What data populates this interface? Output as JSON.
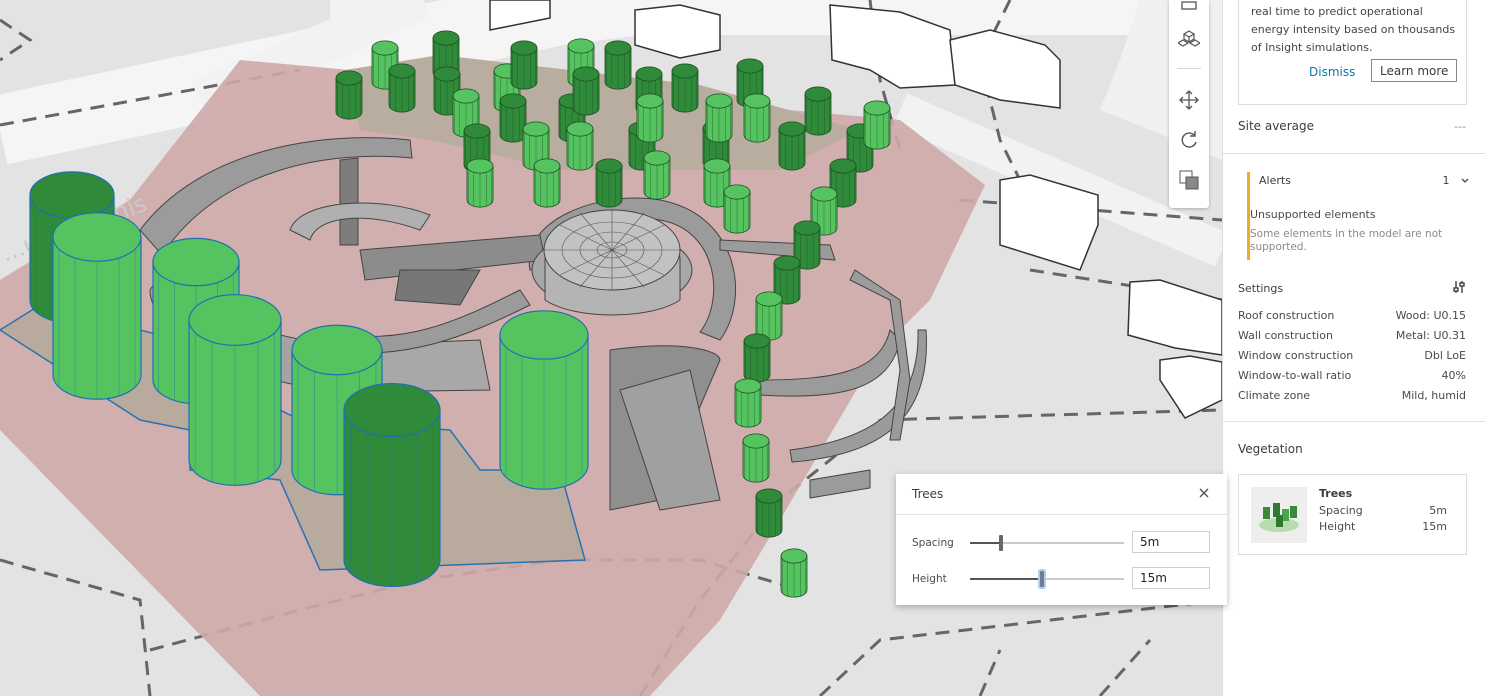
{
  "viewport": {
    "street_label": "...ue Merchis"
  },
  "toolbar": {
    "buttons": [
      {
        "icon": "ruler-icon"
      },
      {
        "icon": "cubes-icon"
      },
      {
        "icon": "pan-icon"
      },
      {
        "icon": "orbit-icon"
      },
      {
        "icon": "section-icon"
      }
    ]
  },
  "panel": {
    "info_card": {
      "text": "real time to predict operational energy intensity based on thousands of Insight simulations.",
      "dismiss_label": "Dismiss",
      "learn_more_label": "Learn more"
    },
    "site_average": {
      "label": "Site average",
      "value": "---"
    },
    "alerts": {
      "label": "Alerts",
      "count": "1",
      "title": "Unsupported elements",
      "description": "Some elements in the model are not supported.",
      "accent_color": "#f0ab26"
    },
    "settings": {
      "title": "Settings",
      "items": [
        {
          "label": "Roof construction",
          "value": "Wood: U0.15"
        },
        {
          "label": "Wall construction",
          "value": "Metal: U0.31"
        },
        {
          "label": "Window construction",
          "value": "Dbl LoE"
        },
        {
          "label": "Window-to-wall ratio",
          "value": "40%"
        },
        {
          "label": "Climate zone",
          "value": "Mild, humid"
        }
      ]
    },
    "vegetation": {
      "title": "Vegetation",
      "card": {
        "name": "Trees",
        "spacing_label": "Spacing",
        "spacing_value": "5m",
        "height_label": "Height",
        "height_value": "15m"
      }
    }
  },
  "trees_dialog": {
    "title": "Trees",
    "spacing": {
      "label": "Spacing",
      "value": "5m",
      "slider_fraction": 0.2
    },
    "height": {
      "label": "Height",
      "value": "15m",
      "slider_fraction": 0.47
    }
  },
  "colors": {
    "tree_dark": "#2f8a3a",
    "tree_light": "#55c35f",
    "site_pink": "#cfa3a3",
    "accent_blue": "#0b78b4"
  }
}
